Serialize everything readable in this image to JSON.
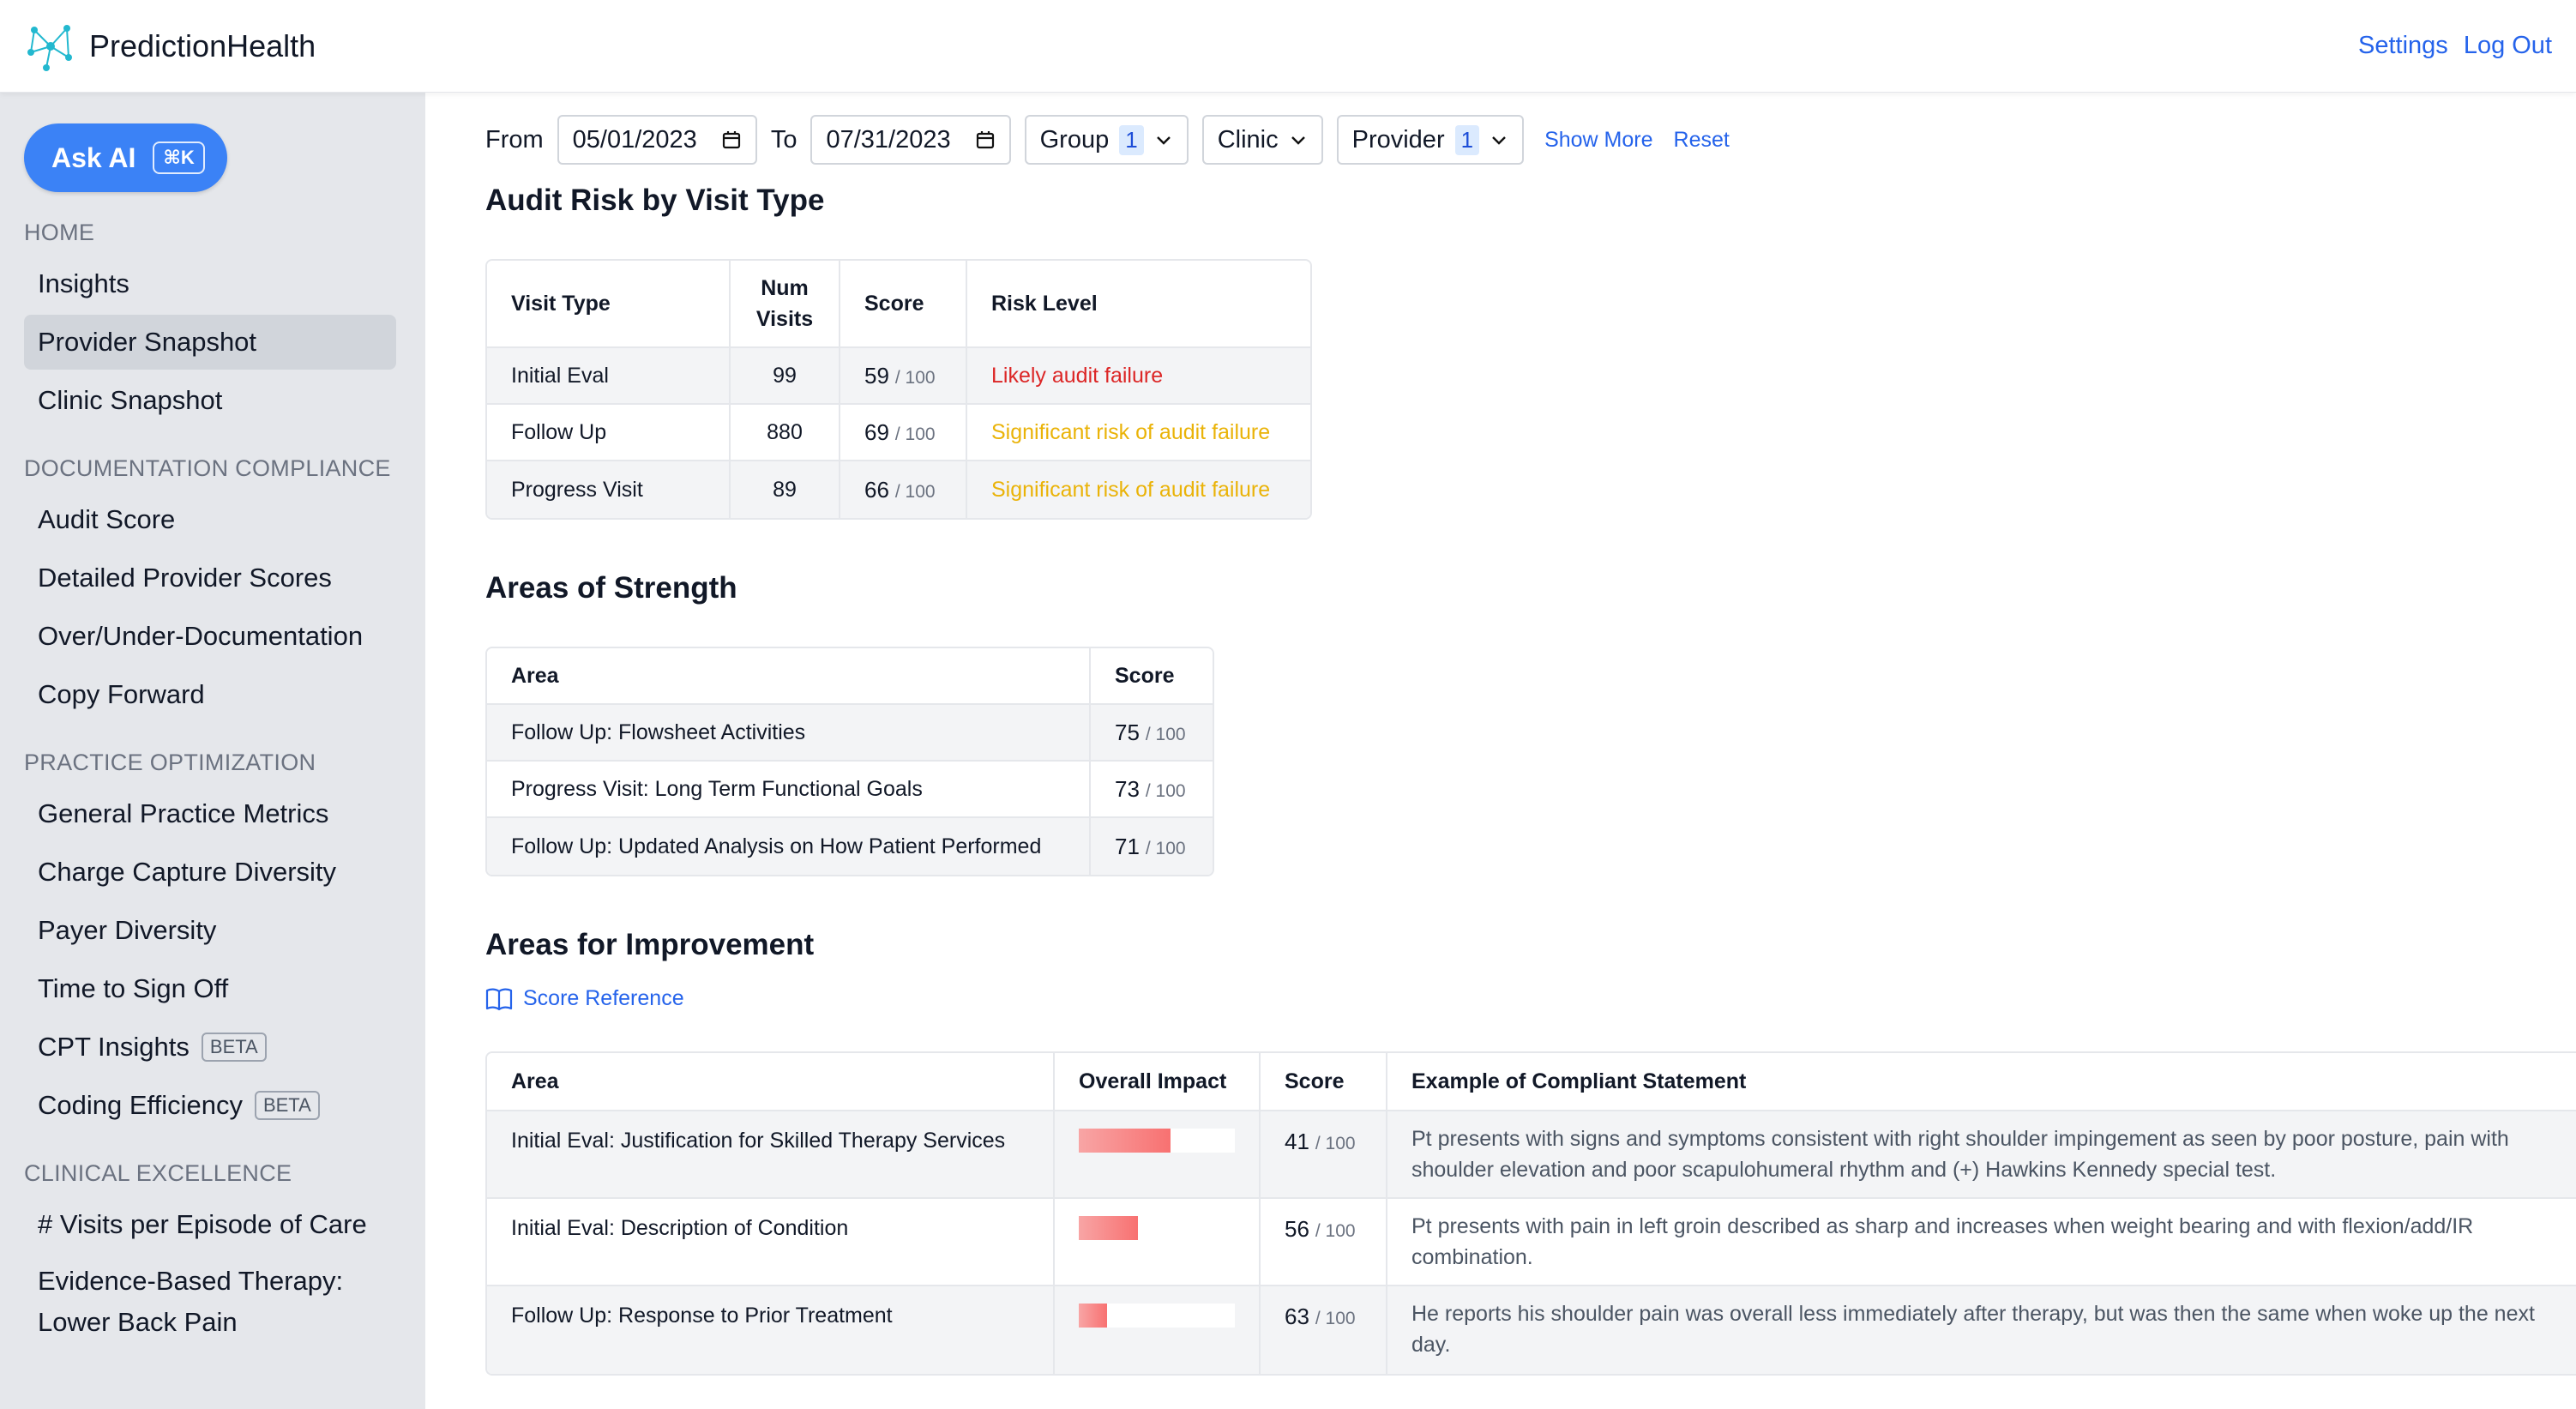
{
  "app": {
    "name": "PredictionHealth",
    "links": {
      "settings": "Settings",
      "logout": "Log Out"
    }
  },
  "sidebar": {
    "ask_ai": {
      "label": "Ask AI",
      "shortcut": "⌘K"
    },
    "sections": [
      {
        "heading": "HOME",
        "items": [
          {
            "label": "Insights"
          },
          {
            "label": "Provider Snapshot",
            "active": true
          },
          {
            "label": "Clinic Snapshot"
          }
        ]
      },
      {
        "heading": "DOCUMENTATION COMPLIANCE",
        "items": [
          {
            "label": "Audit Score"
          },
          {
            "label": "Detailed Provider Scores"
          },
          {
            "label": "Over/Under-Documentation"
          },
          {
            "label": "Copy Forward"
          }
        ]
      },
      {
        "heading": "PRACTICE OPTIMIZATION",
        "items": [
          {
            "label": "General Practice Metrics"
          },
          {
            "label": "Charge Capture Diversity"
          },
          {
            "label": "Payer Diversity"
          },
          {
            "label": "Time to Sign Off"
          },
          {
            "label": "CPT Insights",
            "badge": "BETA"
          },
          {
            "label": "Coding Efficiency",
            "badge": "BETA"
          }
        ]
      },
      {
        "heading": "CLINICAL EXCELLENCE",
        "items": [
          {
            "label": "# Visits per Episode of Care"
          },
          {
            "label": "Evidence-Based Therapy: Lower Back Pain"
          }
        ]
      }
    ]
  },
  "filters": {
    "from_label": "From",
    "from_value": "05/01/2023",
    "to_label": "To",
    "to_value": "07/31/2023",
    "group_label": "Group",
    "group_count": "1",
    "clinic_label": "Clinic",
    "provider_label": "Provider",
    "provider_count": "1",
    "show_more": "Show More",
    "reset": "Reset"
  },
  "audit_risk": {
    "title": "Audit Risk by Visit Type",
    "headers": {
      "visit_type": "Visit Type",
      "num_visits_1": "Num",
      "num_visits_2": "Visits",
      "score": "Score",
      "risk": "Risk Level"
    },
    "score_max": "/ 100",
    "rows": [
      {
        "visit_type": "Initial Eval",
        "num_visits": "99",
        "score": "59",
        "risk": "Likely audit failure"
      },
      {
        "visit_type": "Follow Up",
        "num_visits": "880",
        "score": "69",
        "risk": "Significant risk of audit failure"
      },
      {
        "visit_type": "Progress Visit",
        "num_visits": "89",
        "score": "66",
        "risk": "Significant risk of audit failure"
      }
    ]
  },
  "strength": {
    "title": "Areas of Strength",
    "headers": {
      "area": "Area",
      "score": "Score"
    },
    "score_max": "/ 100",
    "rows": [
      {
        "area": "Follow Up: Flowsheet Activities",
        "score": "75"
      },
      {
        "area": "Progress Visit: Long Term Functional Goals",
        "score": "73"
      },
      {
        "area": "Follow Up: Updated Analysis on How Patient Performed",
        "score": "71"
      }
    ]
  },
  "improvement": {
    "title": "Areas for Improvement",
    "score_reference": "Score Reference",
    "headers": {
      "area": "Area",
      "impact": "Overall Impact",
      "score": "Score",
      "example": "Example of Compliant Statement"
    },
    "score_max": "/ 100",
    "rows": [
      {
        "area": "Initial Eval: Justification for Skilled Therapy Services",
        "impact_pct": 59,
        "score": "41",
        "example": "Pt presents with signs and symptoms consistent with right shoulder impingement as seen by poor posture, pain with shoulder elevation and poor scapulohumeral rhythm and (+) Hawkins Kennedy special test."
      },
      {
        "area": "Initial Eval: Description of Condition",
        "impact_pct": 38,
        "score": "56",
        "example": "Pt presents with pain in left groin described as sharp and increases when weight bearing and with flexion/add/IR combination."
      },
      {
        "area": "Follow Up: Response to Prior Treatment",
        "impact_pct": 18,
        "score": "63",
        "example": "He reports his shoulder pain was overall less immediately after therapy, but was then the same when woke up the next day."
      }
    ]
  },
  "colors": {
    "accent": "#3b82f6",
    "link": "#2563eb",
    "risk_high": "#dc2626",
    "risk_medium": "#eab308",
    "impact_bar": "#f87171"
  }
}
